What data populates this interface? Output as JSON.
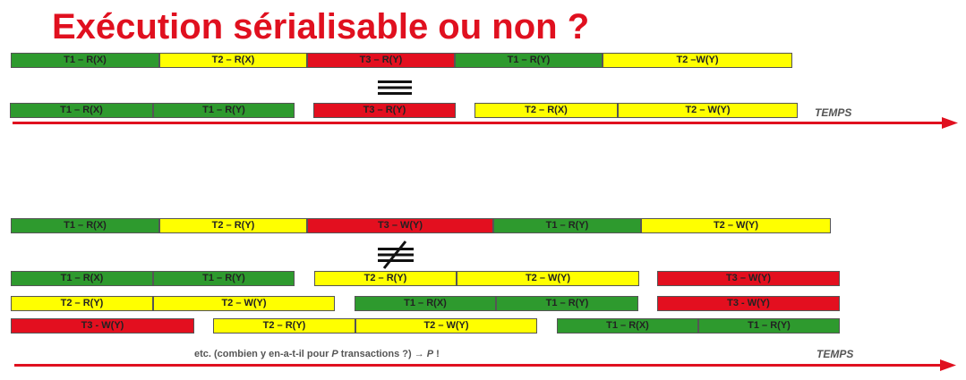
{
  "title": "Exécution sérialisable ou non ?",
  "colors": {
    "title": "#e0101f",
    "arrow": "#e0101f",
    "green": "#2e9a2e",
    "yellow": "#ffff00",
    "red": "#e30f1f"
  },
  "section1": {
    "top_row": [
      "T1 – R(X)",
      "T2 – R(X)",
      "T3 – R(Y)",
      "T1 – R(Y)",
      "T2 –W(Y)"
    ],
    "relation_symbol": "equivalent",
    "serial_row": [
      "T1 – R(X)",
      "T1 – R(Y)",
      "T3 – R(Y)",
      "T2 – R(X)",
      "T2 – W(Y)"
    ],
    "time_label": "TEMPS"
  },
  "section2": {
    "top_row": [
      "T1 – R(X)",
      "T2 – R(Y)",
      "T3 – W(Y)",
      "T1 – R(Y)",
      "T2 – W(Y)"
    ],
    "relation_symbol": "not-equivalent",
    "serial_row_1": [
      "T1 – R(X)",
      "T1 – R(Y)",
      "T2 – R(Y)",
      "T2 – W(Y)",
      "T3 – W(Y)"
    ],
    "serial_row_2": [
      "T2 – R(Y)",
      "T2 – W(Y)",
      "T1 – R(X)",
      "T1 – R(Y)",
      "T3 - W(Y)"
    ],
    "serial_row_3": [
      "T3 - W(Y)",
      "T2 – R(Y)",
      "T2 – W(Y)",
      "T1 – R(X)",
      "T1 – R(Y)"
    ],
    "note": {
      "text_before": "etc. (combien y en-a-t-il pour ",
      "p1": "P",
      "text_middle": " transactions ?) ",
      "arrow": "→",
      "p2": " P",
      "text_after": " !"
    },
    "time_label": "TEMPS"
  }
}
